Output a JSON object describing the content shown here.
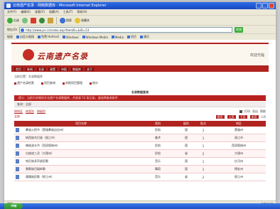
{
  "window": {
    "title": "云南遗产名录 - 网络数据库 - Microsoft Internet Explorer",
    "menu": [
      "文件(F)",
      "编辑(E)",
      "查看(V)",
      "收藏(A)",
      "工具(T)",
      "帮助(H)"
    ]
  },
  "toolbar": {
    "back": "后退",
    "search": "搜索",
    "favorites": "收藏夹"
  },
  "address": {
    "label": "地址(D)",
    "value": "http://www.yn.cn/index.asp?ItemID=&ID=53",
    "go": "转到"
  },
  "links": [
    "链接",
    "自定义链接",
    "免费 Hotmail",
    "Windows",
    "Windows Media",
    "Media",
    "项目",
    "通讯"
  ],
  "site": {
    "logo_text": "云南遗产名录",
    "header_right": "欢迎光临",
    "nav": [
      "首页",
      "新闻",
      "名录",
      "政策",
      "申报",
      "数据库",
      "关于"
    ],
    "breadcrumb": "当前位置：名录数据库",
    "subnav": [
      "遗产名录检索",
      "项目查询",
      "申报项目管理",
      "统计"
    ]
  },
  "section_title": "名录数据查询",
  "alert": "提示：当前为非物质文化遗产名录数据库，共收录 53 条记录，请选择查询条件",
  "info_strip": "查询：全部",
  "filters": [
    "按地区",
    "按类别",
    "按级别"
  ],
  "secondary_label": "全部",
  "right_tools": [
    "打印",
    "导出",
    "帮助"
  ],
  "page_ctrls": [
    "首页",
    "上页",
    "下页",
    "末页",
    "1/6"
  ],
  "table": {
    "headers": [
      "",
      "项目名称",
      "类别",
      "级别",
      "批次",
      "地区"
    ],
    "rows": [
      [
        "",
        "彝族火把节（楚雄彝族自治州）",
        "民俗",
        "国",
        "1",
        "楚雄州"
      ],
      [
        "",
        "纳西族东巴画（丽江市）",
        "美术",
        "国",
        "1",
        "丽江市"
      ],
      [
        "",
        "傣族泼水节（西双版纳州）",
        "民俗",
        "国",
        "1",
        "西双版纳州"
      ],
      [
        "",
        "白族绕三灵（大理州）",
        "民俗",
        "省",
        "2",
        "大理州"
      ],
      [
        "",
        "哈尼族多声部民歌",
        "音乐",
        "国",
        "1",
        "红河州"
      ],
      [
        "",
        "景颇族目瑙纵歌",
        "舞蹈",
        "国",
        "1",
        "德宏州"
      ],
      [
        "",
        "傈僳族民歌（怒江州）",
        "音乐",
        "省",
        "2",
        "怒江州"
      ]
    ]
  },
  "status": {
    "left": "完毕",
    "right": "Internet"
  },
  "taskbar": {
    "start": "开始"
  },
  "colors": {
    "brand_red": "#b0231f",
    "xp_blue": "#2c6ee6"
  }
}
